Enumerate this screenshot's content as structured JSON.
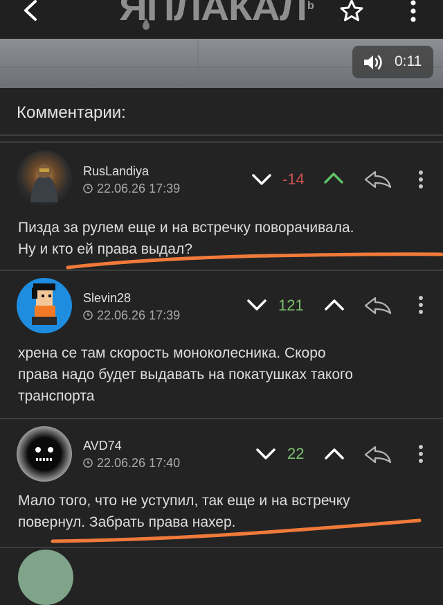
{
  "app": {
    "logo_text": "ЯПЛАКАЛ",
    "logo_mark": "b",
    "accent_negative": "#d05252",
    "accent_positive": "#68c05a"
  },
  "video": {
    "time": "0:11"
  },
  "section": {
    "title": "Комментарии:"
  },
  "comments": [
    {
      "user": "RusLandiya",
      "datetime": "22.06.26 17:39",
      "score": "-14",
      "score_color": "#d05252",
      "upvoted": true,
      "text_lines": [
        "Пизда за рулем еще и на встречку поворачивала.",
        "Ну и кто ей права выдал?"
      ]
    },
    {
      "user": "Slevin28",
      "datetime": "22.06.26 17:39",
      "score": "121",
      "score_color": "#7ec26f",
      "upvoted": false,
      "text_lines": [
        "хрена се там скорость моноколесника. Скоро",
        "права надо будет выдавать на покатушках такого",
        "транспорта"
      ]
    },
    {
      "user": "AVD74",
      "datetime": "22.06.26 17:40",
      "score": "22",
      "score_color": "#7ec26f",
      "upvoted": false,
      "text_lines": [
        "Мало того, что не уступил, так еще и на встречку",
        "повернул. Забрать права нахер."
      ]
    }
  ]
}
